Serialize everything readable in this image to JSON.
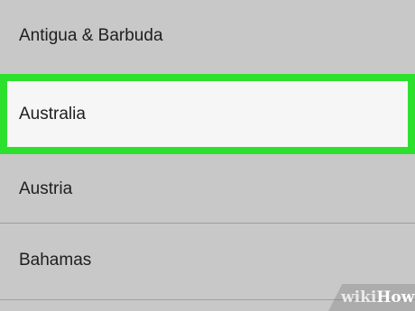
{
  "list": {
    "items": [
      {
        "label": "Antigua & Barbuda",
        "selected": false
      },
      {
        "label": "Australia",
        "selected": true
      },
      {
        "label": "Austria",
        "selected": false
      },
      {
        "label": "Bahamas",
        "selected": false
      }
    ]
  },
  "highlight_color": "#2ee02e",
  "watermark": {
    "prefix": "wiki",
    "suffix": "How"
  }
}
